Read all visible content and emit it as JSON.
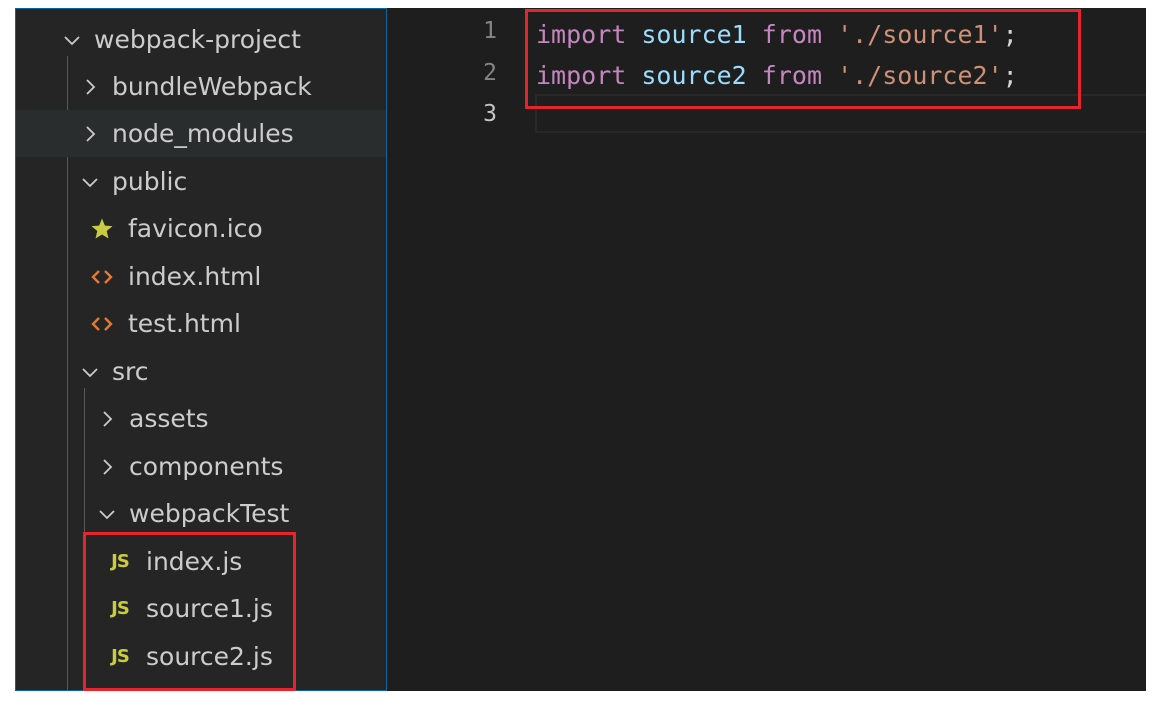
{
  "explorer": {
    "items": [
      {
        "label": "webpack-project",
        "type": "folder",
        "expanded": true
      },
      {
        "label": "bundleWebpack",
        "type": "folder",
        "expanded": false
      },
      {
        "label": "node_modules",
        "type": "folder",
        "expanded": false
      },
      {
        "label": "public",
        "type": "folder",
        "expanded": true
      },
      {
        "label": "favicon.ico",
        "type": "file",
        "icon": "star-icon"
      },
      {
        "label": "index.html",
        "type": "file",
        "icon": "html-icon"
      },
      {
        "label": "test.html",
        "type": "file",
        "icon": "html-icon"
      },
      {
        "label": "src",
        "type": "folder",
        "expanded": true
      },
      {
        "label": "assets",
        "type": "folder",
        "expanded": false
      },
      {
        "label": "components",
        "type": "folder",
        "expanded": false
      },
      {
        "label": "webpackTest",
        "type": "folder",
        "expanded": true
      },
      {
        "label": "index.js",
        "type": "file",
        "icon": "js-icon",
        "icon_text": "JS"
      },
      {
        "label": "source1.js",
        "type": "file",
        "icon": "js-icon",
        "icon_text": "JS"
      },
      {
        "label": "source2.js",
        "type": "file",
        "icon": "js-icon",
        "icon_text": "JS"
      }
    ]
  },
  "editor": {
    "line_numbers": [
      "1",
      "2",
      "3"
    ],
    "active_line": "3",
    "lines": [
      {
        "keyword": "import",
        "identifier": "source1",
        "from": "from",
        "string": "'./source1'",
        "end": ";"
      },
      {
        "keyword": "import",
        "identifier": "source2",
        "from": "from",
        "string": "'./source2'",
        "end": ";"
      },
      {
        "keyword": "",
        "identifier": "",
        "from": "",
        "string": "",
        "end": ""
      }
    ]
  },
  "colors": {
    "background": "#1e1e1e",
    "sidebar": "#252526",
    "keyword": "#c586c0",
    "identifier": "#9cdcfe",
    "string": "#ce9178",
    "annotation": "#e5242d",
    "js_icon": "#cbcb41",
    "html_icon": "#e37933"
  }
}
